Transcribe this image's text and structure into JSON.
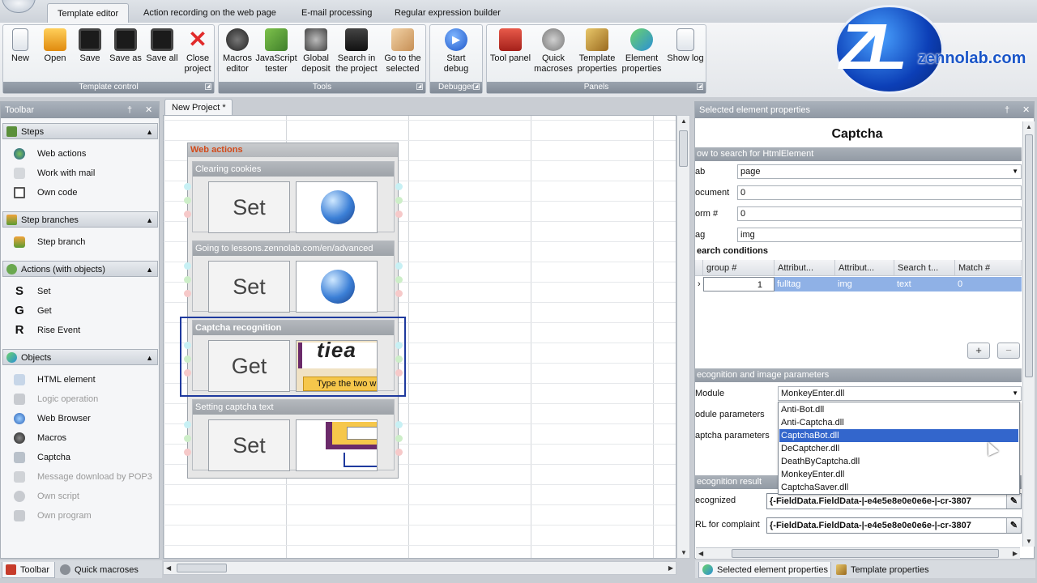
{
  "menu_tabs": [
    "Template editor",
    "Action recording on the web page",
    "E-mail processing",
    "Regular expression builder"
  ],
  "ribbon": {
    "groups": [
      {
        "title": "Template control",
        "buttons": [
          "New",
          "Open",
          "Save",
          "Save as",
          "Save all",
          "Close\nproject"
        ]
      },
      {
        "title": "Tools",
        "buttons": [
          "Macros\neditor",
          "JavaScript\ntester",
          "Global\ndeposit",
          "Search in\nthe project",
          "Go to the\nselected"
        ]
      },
      {
        "title": "Debugger",
        "buttons": [
          "Start\ndebug"
        ]
      },
      {
        "title": "Panels",
        "buttons": [
          "Tool panel",
          "Quick\nmacroses",
          "Template\nproperties",
          "Element\nproperties",
          "Show log"
        ]
      }
    ]
  },
  "logo": {
    "letters": "ZL",
    "text": "zennolab.com"
  },
  "toolbar": {
    "title": "Toolbar",
    "pin": "†",
    "close": "✕",
    "sections": [
      {
        "title": "Steps",
        "items": [
          {
            "label": "Web actions",
            "disabled": false
          },
          {
            "label": "Work with mail",
            "disabled": false
          },
          {
            "label": "Own code",
            "disabled": false
          }
        ]
      },
      {
        "title": "Step branches",
        "items": [
          {
            "label": "Step branch",
            "disabled": false
          }
        ]
      },
      {
        "title": "Actions (with objects)",
        "items": [
          {
            "label": "Set",
            "glyph": "S",
            "disabled": false
          },
          {
            "label": "Get",
            "glyph": "G",
            "disabled": false
          },
          {
            "label": "Rise Event",
            "glyph": "R",
            "disabled": false
          }
        ]
      },
      {
        "title": "Objects",
        "items": [
          {
            "label": "HTML element",
            "disabled": false
          },
          {
            "label": "Logic operation",
            "disabled": true
          },
          {
            "label": "Web Browser",
            "disabled": false
          },
          {
            "label": "Macros",
            "disabled": false
          },
          {
            "label": "Captcha",
            "disabled": false
          },
          {
            "label": "Message download by POP3",
            "disabled": true
          },
          {
            "label": "Own script",
            "disabled": true
          },
          {
            "label": "Own program",
            "disabled": true
          }
        ]
      }
    ],
    "bottom_tabs": [
      "Toolbar",
      "Quick macroses"
    ]
  },
  "doc_tab": "New Project *",
  "web_actions": {
    "title": "Web actions",
    "steps": [
      {
        "title": "Clearing cookies",
        "action": "Set",
        "image": "globe"
      },
      {
        "title": "Going to lessons.zennolab.com/en/advanced",
        "action": "Set",
        "image": "globe"
      },
      {
        "title": "Captcha recognition",
        "action": "Get",
        "image": "captcha",
        "captcha_word": "tiea",
        "captcha_hint": "Type the two w"
      },
      {
        "title": "Setting captcha text",
        "action": "Set",
        "image": "form"
      }
    ]
  },
  "props": {
    "panel_title": "Selected element properties",
    "element": "Captcha",
    "cat_search": "ow to search for HtmlElement",
    "fields": [
      {
        "label": "ab",
        "value": "page",
        "dropdown": true
      },
      {
        "label": "ocument",
        "value": "0",
        "dropdown": false
      },
      {
        "label": "orm #",
        "value": "0",
        "dropdown": false
      },
      {
        "label": "ag",
        "value": "img",
        "dropdown": false
      }
    ],
    "cat_conditions": "earch conditions",
    "grid_headers": [
      "group #",
      "Attribut...",
      "Attribut...",
      "Search t...",
      "Match #"
    ],
    "grid_row": {
      "arrow": "›",
      "group": "1",
      "attr1": "fulltag",
      "attr2": "img",
      "search": "text",
      "match": "0"
    },
    "add_btn": "+",
    "remove_btn": "−",
    "cat_recognition": "ecognition and image parameters",
    "module_label": "Module",
    "module_value": "MonkeyEnter.dll",
    "module_params_label": "odule parameters",
    "captcha_params_label": "aptcha parameters",
    "dropdown_options": [
      "Anti-Bot.dll",
      "Anti-Captcha.dll",
      "CaptchaBot.dll",
      "DeCaptcher.dll",
      "DeathByCaptcha.dll",
      "MonkeyEnter.dll",
      "CaptchaSaver.dll"
    ],
    "dropdown_highlight": "CaptchaBot.dll",
    "cat_result": "ecognition result",
    "recognized_label": "ecognized",
    "recognized_value": "{-FieldData.FieldData-|-e4e5e8e0e0e6e-|-cr-3807",
    "complaint_label": "RL for complaint",
    "complaint_value": "{-FieldData.FieldData-|-e4e5e8e0e0e6e-|-cr-3807",
    "bottom_tabs": [
      "Selected element properties",
      "Template properties"
    ]
  }
}
